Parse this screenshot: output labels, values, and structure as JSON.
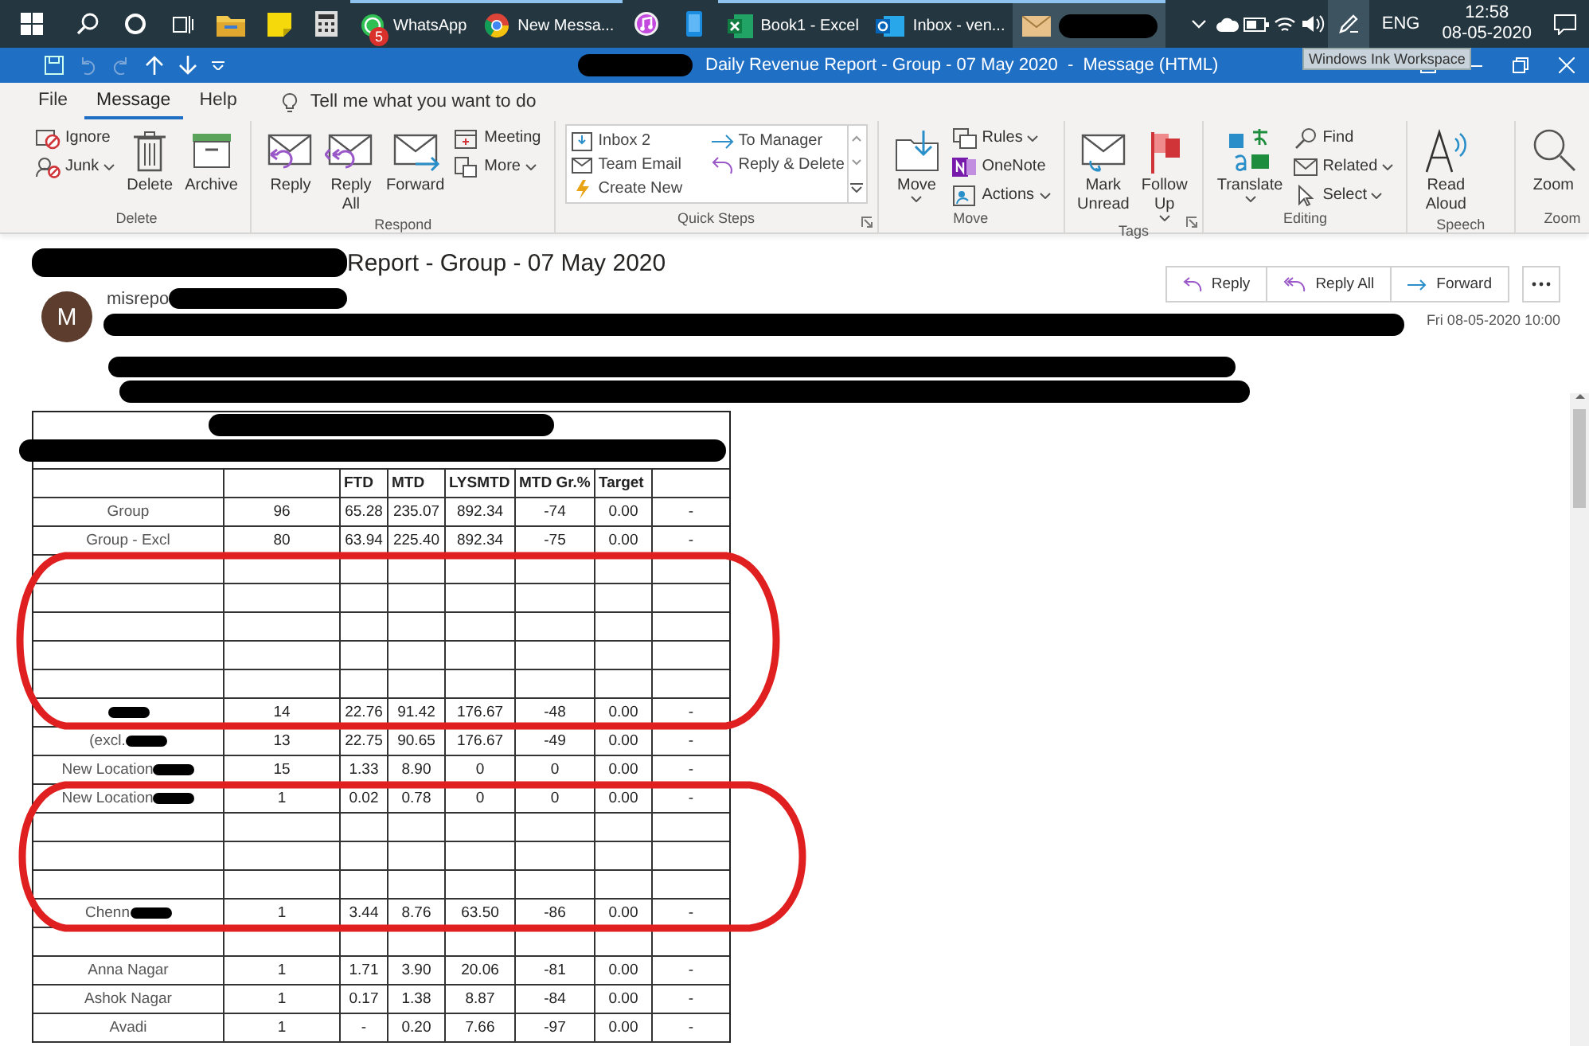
{
  "taskbar": {
    "items": [
      {
        "kind": "start"
      },
      {
        "kind": "search"
      },
      {
        "kind": "cortana"
      },
      {
        "kind": "task-view"
      },
      {
        "kind": "explorer"
      },
      {
        "kind": "sticky-notes"
      },
      {
        "kind": "calculator"
      },
      {
        "kind": "whatsapp",
        "label": "WhatsApp",
        "badge": "5",
        "running": true
      },
      {
        "kind": "chrome",
        "label": "New Messa...",
        "running": true
      },
      {
        "kind": "itunes"
      },
      {
        "kind": "phone"
      },
      {
        "kind": "excel",
        "label": "Book1 - Excel",
        "running": true
      },
      {
        "kind": "outlook",
        "label": "Inbox - ven...",
        "running": true
      },
      {
        "kind": "mail",
        "redacted": true,
        "running": true,
        "selected": true
      }
    ],
    "tray": [
      {
        "kind": "chevron"
      },
      {
        "kind": "cloud"
      },
      {
        "kind": "battery"
      },
      {
        "kind": "wifi"
      },
      {
        "kind": "volume"
      },
      {
        "kind": "pen"
      }
    ],
    "language": "ENG",
    "time": "12:58",
    "date": "08-05-2020"
  },
  "window": {
    "title": "Daily Revenue Report - Group - 07 May 2020  -  Message (HTML)",
    "title_redacted": true,
    "tooltip": "Windows Ink Workspace"
  },
  "menu": {
    "tabs": [
      {
        "label": "File",
        "selected": false
      },
      {
        "label": "Message",
        "selected": true
      },
      {
        "label": "Help",
        "selected": false
      }
    ],
    "tell_me": "Tell me what you want to do"
  },
  "ribbon": {
    "groups": [
      {
        "label": "Delete",
        "columns": [
          {
            "kind": "stack",
            "items": [
              {
                "label": "Ignore",
                "dropdown": false
              },
              {
                "label": "Junk",
                "dropdown": true
              }
            ]
          },
          {
            "kind": "large",
            "label": "Delete",
            "dropdown": false
          },
          {
            "kind": "large",
            "label": "Archive",
            "dropdown": false
          }
        ]
      },
      {
        "label": "Respond",
        "columns": [
          {
            "kind": "large",
            "label": "Reply",
            "dropdown": false
          },
          {
            "kind": "large",
            "label": "Reply\nAll",
            "dropdown": false
          },
          {
            "kind": "large",
            "label": "Forward",
            "dropdown": false
          },
          {
            "kind": "stack",
            "items": [
              {
                "label": "Meeting",
                "dropdown": false
              },
              {
                "label": "More",
                "dropdown": true
              }
            ]
          }
        ]
      },
      {
        "label": "Quick Steps",
        "launcher": true,
        "columns": [
          {
            "kind": "gallery",
            "items": [
              {
                "label": "Inbox 2"
              },
              {
                "label": "To Manager"
              },
              {
                "label": "Team Email"
              },
              {
                "label": "Reply & Delete"
              },
              {
                "label": "Create New"
              }
            ]
          }
        ]
      },
      {
        "label": "Move",
        "columns": [
          {
            "kind": "large",
            "label": "Move",
            "dropdown": true
          },
          {
            "kind": "stack",
            "items": [
              {
                "label": "Rules",
                "dropdown": true
              },
              {
                "label": "OneNote",
                "dropdown": false
              },
              {
                "label": "Actions",
                "dropdown": true
              }
            ]
          }
        ]
      },
      {
        "label": "Tags",
        "launcher": true,
        "columns": [
          {
            "kind": "large",
            "label": "Mark\nUnread",
            "dropdown": false
          },
          {
            "kind": "large",
            "label": "Follow\nUp",
            "dropdown": true
          }
        ]
      },
      {
        "label": "Editing",
        "columns": [
          {
            "kind": "large",
            "label": "Translate",
            "dropdown": true
          },
          {
            "kind": "stack",
            "items": [
              {
                "label": "Find",
                "dropdown": false
              },
              {
                "label": "Related",
                "dropdown": true
              },
              {
                "label": "Select",
                "dropdown": true
              }
            ]
          }
        ]
      },
      {
        "label": "Speech",
        "columns": [
          {
            "kind": "large",
            "label": "Read\nAloud",
            "dropdown": false
          }
        ]
      },
      {
        "label": "Zoom",
        "columns": [
          {
            "kind": "large",
            "label": "Zoom",
            "dropdown": false
          }
        ]
      }
    ]
  },
  "message": {
    "subject": "Report - Group - 07 May 2020",
    "subject_redacted": true,
    "avatar": "M",
    "sender": "misrepo",
    "sender_redacted": true,
    "date": "Fri 08-05-2020 10:00",
    "actions": [
      {
        "kind": "reply",
        "label": "Reply"
      },
      {
        "kind": "reply-all",
        "label": "Reply All"
      },
      {
        "kind": "forward",
        "label": "Forward"
      },
      {
        "kind": "more"
      }
    ]
  },
  "table": {
    "columns": [
      null,
      null,
      "FTD",
      "MTD",
      "LYSMTD",
      "MTD Gr.%",
      "Target",
      null
    ],
    "rows": [
      {
        "kind": "redacted"
      },
      {
        "kind": "data",
        "label": "Group",
        "cells": [
          "96",
          "65.28",
          "235.07",
          "892.34",
          "-74",
          "0.00",
          "-"
        ]
      },
      {
        "kind": "data",
        "label": "Group - Excl",
        "cells": [
          "80",
          "63.94",
          "225.40",
          "892.34",
          "-75",
          "0.00",
          "-"
        ]
      },
      {
        "kind": "blank"
      },
      {
        "kind": "blank"
      },
      {
        "kind": "blank"
      },
      {
        "kind": "blank"
      },
      {
        "kind": "blank"
      },
      {
        "kind": "data",
        "redacted": true,
        "cells": [
          "14",
          "22.76",
          "91.42",
          "176.67",
          "-48",
          "0.00",
          "-"
        ]
      },
      {
        "kind": "data",
        "redacted": true,
        "label": "(excl.",
        "cells": [
          "13",
          "22.75",
          "90.65",
          "176.67",
          "-49",
          "0.00",
          "-"
        ]
      },
      {
        "kind": "data",
        "redacted": true,
        "label": "New Location",
        "cells": [
          "15",
          "1.33",
          "8.90",
          "0",
          "0",
          "0.00",
          "-"
        ]
      },
      {
        "kind": "data",
        "redacted": true,
        "label": "New Location",
        "cells": [
          "1",
          "0.02",
          "0.78",
          "0",
          "0",
          "0.00",
          "-"
        ]
      },
      {
        "kind": "blank"
      },
      {
        "kind": "blank"
      },
      {
        "kind": "blank"
      },
      {
        "kind": "data",
        "redacted": true,
        "label": "Chenn",
        "cells": [
          "1",
          "3.44",
          "8.76",
          "63.50",
          "-86",
          "0.00",
          "-"
        ]
      },
      {
        "kind": "blank"
      },
      {
        "kind": "data",
        "label": "Anna Nagar",
        "cells": [
          "1",
          "1.71",
          "3.90",
          "20.06",
          "-81",
          "0.00",
          "-"
        ]
      },
      {
        "kind": "data",
        "label": "Ashok Nagar",
        "cells": [
          "1",
          "0.17",
          "1.38",
          "8.87",
          "-84",
          "0.00",
          "-"
        ]
      },
      {
        "kind": "data",
        "label": "Avadi",
        "cells": [
          "1",
          "-",
          "0.20",
          "7.66",
          "-97",
          "0.00",
          "-"
        ]
      }
    ]
  }
}
